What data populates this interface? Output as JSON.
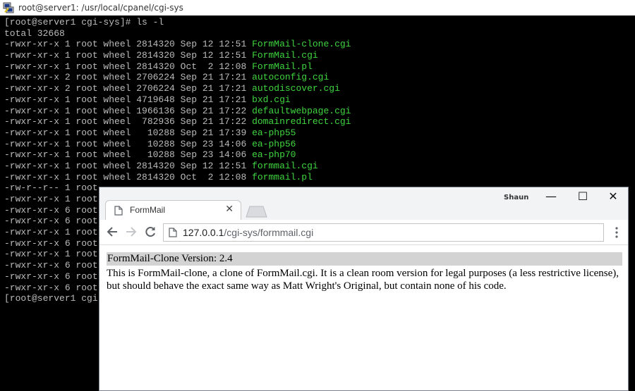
{
  "terminal": {
    "title": "root@server1: /usr/local/cpanel/cgi-sys",
    "lines": [
      {
        "meta": "[root@server1 cgi-sys]# ls -l",
        "name": ""
      },
      {
        "meta": "total 32668",
        "name": ""
      },
      {
        "meta": "-rwxr-xr-x 1 root wheel 2814320 Sep 12 12:51 ",
        "name": "FormMail-clone.cgi"
      },
      {
        "meta": "-rwxr-xr-x 1 root wheel 2814320 Sep 12 12:51 ",
        "name": "FormMail.cgi"
      },
      {
        "meta": "-rwxr-xr-x 1 root wheel 2814320 Oct  2 12:08 ",
        "name": "FormMail.pl"
      },
      {
        "meta": "-rwxr-xr-x 2 root wheel 2706224 Sep 21 17:21 ",
        "name": "autoconfig.cgi"
      },
      {
        "meta": "-rwxr-xr-x 2 root wheel 2706224 Sep 21 17:21 ",
        "name": "autodiscover.cgi"
      },
      {
        "meta": "-rwxr-xr-x 1 root wheel 4719648 Sep 21 17:21 ",
        "name": "bxd.cgi"
      },
      {
        "meta": "-rwxr-xr-x 1 root wheel 1966136 Sep 21 17:22 ",
        "name": "defaultwebpage.cgi"
      },
      {
        "meta": "-rwxr-xr-x 1 root wheel  782936 Sep 21 17:22 ",
        "name": "domainredirect.cgi"
      },
      {
        "meta": "-rwxr-xr-x 1 root wheel   10288 Sep 21 17:39 ",
        "name": "ea-php55"
      },
      {
        "meta": "-rwxr-xr-x 1 root wheel   10288 Sep 23 14:06 ",
        "name": "ea-php56"
      },
      {
        "meta": "-rwxr-xr-x 1 root wheel   10288 Sep 23 14:06 ",
        "name": "ea-php70"
      },
      {
        "meta": "-rwxr-xr-x 1 root wheel 2814320 Sep 12 12:51 ",
        "name": "formmail.cgi"
      },
      {
        "meta": "-rwxr-xr-x 1 root wheel 2814320 Oct  2 12:08 ",
        "name": "formmail.pl"
      },
      {
        "meta": "-rw-r--r-- 1 root",
        "name": ""
      },
      {
        "meta": "-rwxr-xr-x 1 root",
        "name": ""
      },
      {
        "meta": "-rwxr-xr-x 6 root",
        "name": ""
      },
      {
        "meta": "-rwxr-xr-x 6 root",
        "name": ""
      },
      {
        "meta": "-rwxr-xr-x 1 root",
        "name": ""
      },
      {
        "meta": "-rwxr-xr-x 6 root",
        "name": ""
      },
      {
        "meta": "-rwxr-xr-x 1 root",
        "name": ""
      },
      {
        "meta": "-rwxr-xr-x 6 root",
        "name": ""
      },
      {
        "meta": "-rwxr-xr-x 6 root",
        "name": ""
      },
      {
        "meta": "-rwxr-xr-x 6 root",
        "name": ""
      },
      {
        "meta": "[root@server1 cgi",
        "name": ""
      }
    ],
    "text_color": "#bbbbbb",
    "filename_color": "#3fd53f"
  },
  "browser": {
    "tab_title": "FormMail",
    "profile_name": "Shaun",
    "url_host": "127.0.0.1",
    "url_path": "/cgi-sys/formmail.cgi",
    "icons": {
      "tab": "page-icon",
      "tab_close": "close-icon",
      "back": "arrow-left-icon",
      "forward": "arrow-right-icon",
      "reload": "reload-icon",
      "menu": "kebab-menu-icon",
      "minimize": "minimize-icon",
      "maximize": "maximize-icon",
      "close": "close-icon"
    },
    "page": {
      "heading": "FormMail-Clone Version: 2.4",
      "description": "This is FormMail-clone, a clone of FormMail.cgi. It is a clean room version for legal purposes (a less restrictive license), but should behave the exact same way as Matt Wright's Original, but contain none of his code."
    }
  }
}
